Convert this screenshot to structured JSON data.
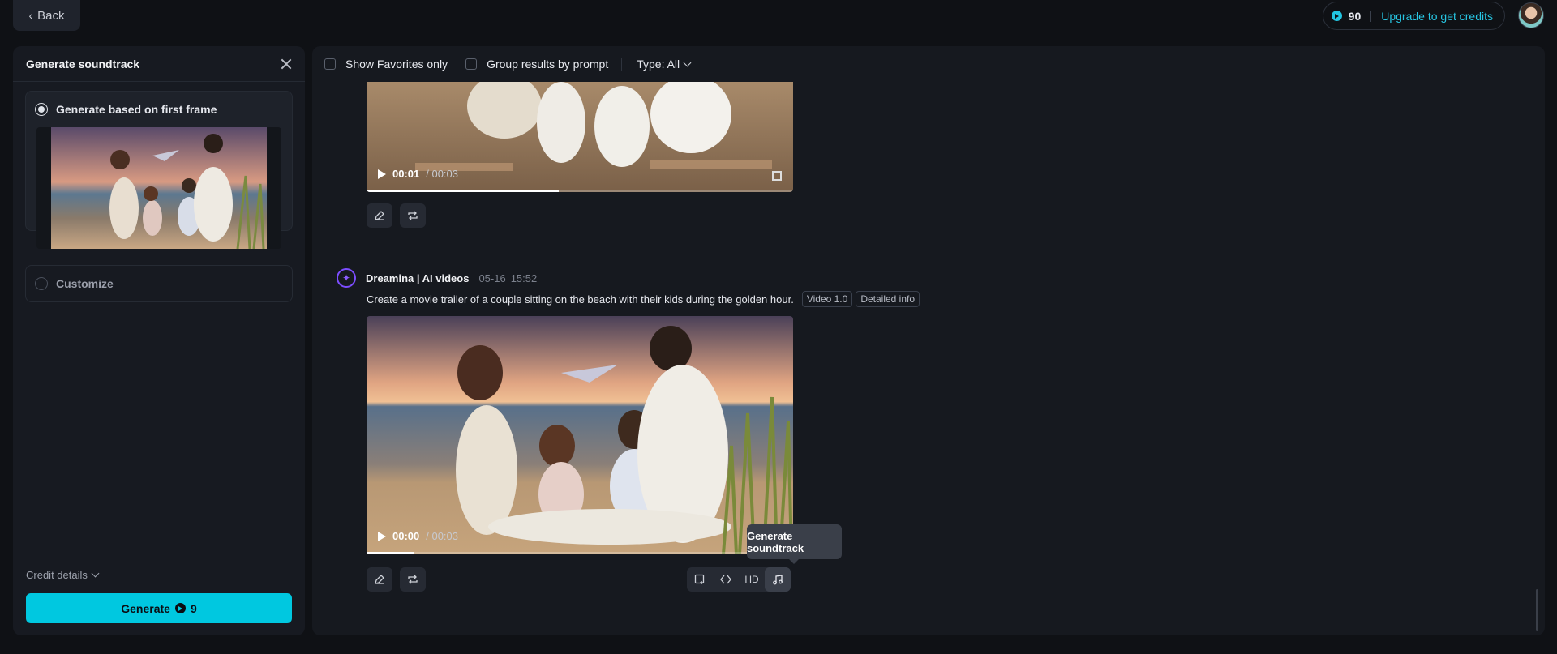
{
  "topbar": {
    "back_label": "Back",
    "credits_amount": "90",
    "upgrade_label": "Upgrade to get credits"
  },
  "left_panel": {
    "title": "Generate soundtrack",
    "options": [
      {
        "label": "Generate based on first frame",
        "selected": true
      },
      {
        "label": "Customize",
        "selected": false
      }
    ],
    "credit_details_label": "Credit details",
    "generate_label": "Generate",
    "generate_cost": "9"
  },
  "filters": {
    "favorites_label": "Show Favorites only",
    "group_label": "Group results by prompt",
    "type_label": "Type: All"
  },
  "videos": [
    {
      "current": "00:01",
      "duration": "/ 00:03",
      "progress": 0.45
    },
    {
      "current": "00:00",
      "duration": "/ 00:03",
      "progress": 0.11
    }
  ],
  "message": {
    "sender": "Dreamina | AI videos",
    "date": "05-16",
    "time": "15:52",
    "prompt": "Create a movie trailer of a couple sitting on the beach with their kids during the golden hour.",
    "tags": [
      "Video 1.0",
      "Detailed info"
    ]
  },
  "toolbar": {
    "hd_label": "HD",
    "tooltip": "Generate soundtrack"
  },
  "colors": {
    "accent": "#00c8e0",
    "bot_purple": "#7c4dff"
  }
}
